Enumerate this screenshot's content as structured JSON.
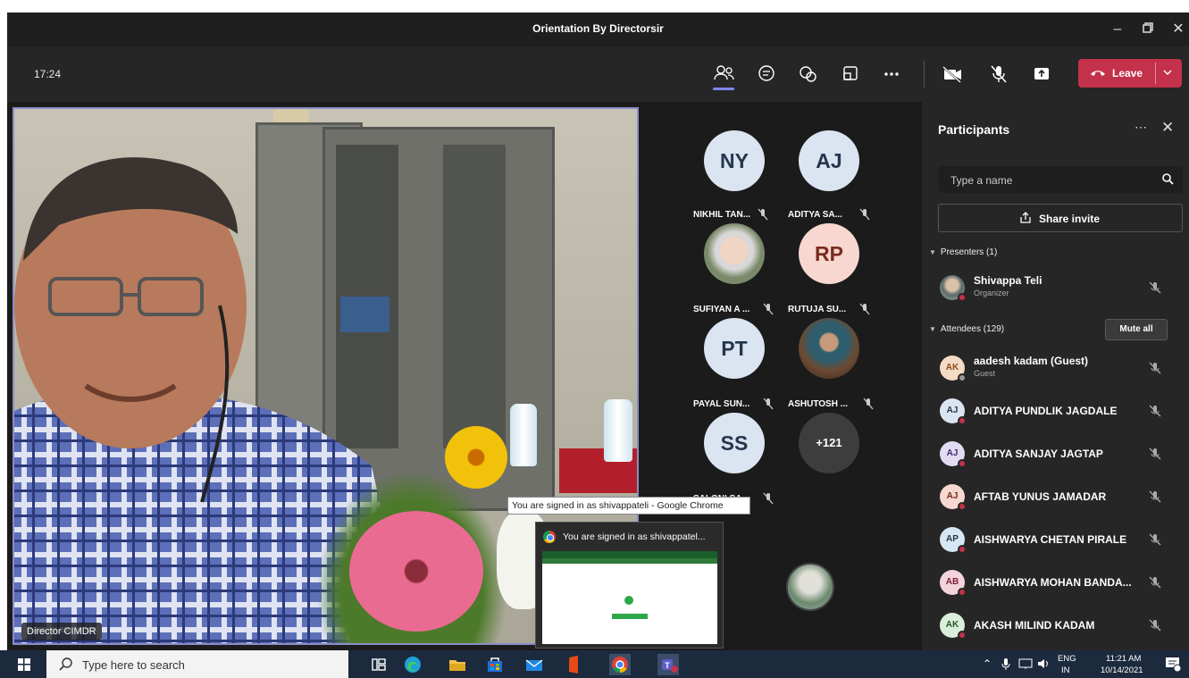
{
  "window": {
    "title": "Orientation By Directorsir"
  },
  "toolbar": {
    "clock": "17:24",
    "leave_label": "Leave"
  },
  "video": {
    "speaker_label": "Director CIMDR"
  },
  "tiles": [
    {
      "initials": "NY",
      "name": "NIKHIL TAN..."
    },
    {
      "initials": "AJ",
      "name": "ADITYA SA..."
    },
    {
      "initials": "",
      "name": "SUFIYAN A ..."
    },
    {
      "initials": "RP",
      "name": "RUTUJA SU..."
    },
    {
      "initials": "PT",
      "name": "PAYAL SUN..."
    },
    {
      "initials": "",
      "name": "ASHUTOSH ..."
    },
    {
      "initials": "SS",
      "name": "SALONI SA..."
    }
  ],
  "overflow_count": "+121",
  "participants": {
    "title": "Participants",
    "search_placeholder": "Type a name",
    "share_invite": "Share invite",
    "presenters_header": "Presenters (1)",
    "attendees_header": "Attendees (129)",
    "mute_all": "Mute all",
    "presenters": [
      {
        "name": "Shivappa Teli",
        "role": "Organizer"
      }
    ],
    "attendees": [
      {
        "initials": "AK",
        "name": "aadesh kadam (Guest)",
        "role": "Guest"
      },
      {
        "initials": "AJ",
        "name": "ADITYA PUNDLIK JAGDALE",
        "role": ""
      },
      {
        "initials": "AJ",
        "name": "ADITYA SANJAY JAGTAP",
        "role": ""
      },
      {
        "initials": "AJ",
        "name": "AFTAB YUNUS JAMADAR",
        "role": ""
      },
      {
        "initials": "AP",
        "name": "AISHWARYA CHETAN PIRALE",
        "role": ""
      },
      {
        "initials": "AB",
        "name": "AISHWARYA MOHAN BANDA...",
        "role": ""
      },
      {
        "initials": "AK",
        "name": "AKASH MILIND KADAM",
        "role": ""
      }
    ]
  },
  "chrome_popup": {
    "tooltip": "You are signed in as shivappateli - Google Chrome",
    "title": "You are signed in as shivappatel..."
  },
  "taskbar": {
    "search_placeholder": "Type here to search",
    "lang_top": "ENG",
    "lang_bottom": "IN",
    "time": "11:21 AM",
    "date": "10/14/2021"
  },
  "colors": {
    "leave": "#c4314b",
    "accent": "#7f85f5",
    "panel_bg": "#262626",
    "stage_bg": "#1b1b1b",
    "taskbar_bg": "#1c2a3e"
  }
}
